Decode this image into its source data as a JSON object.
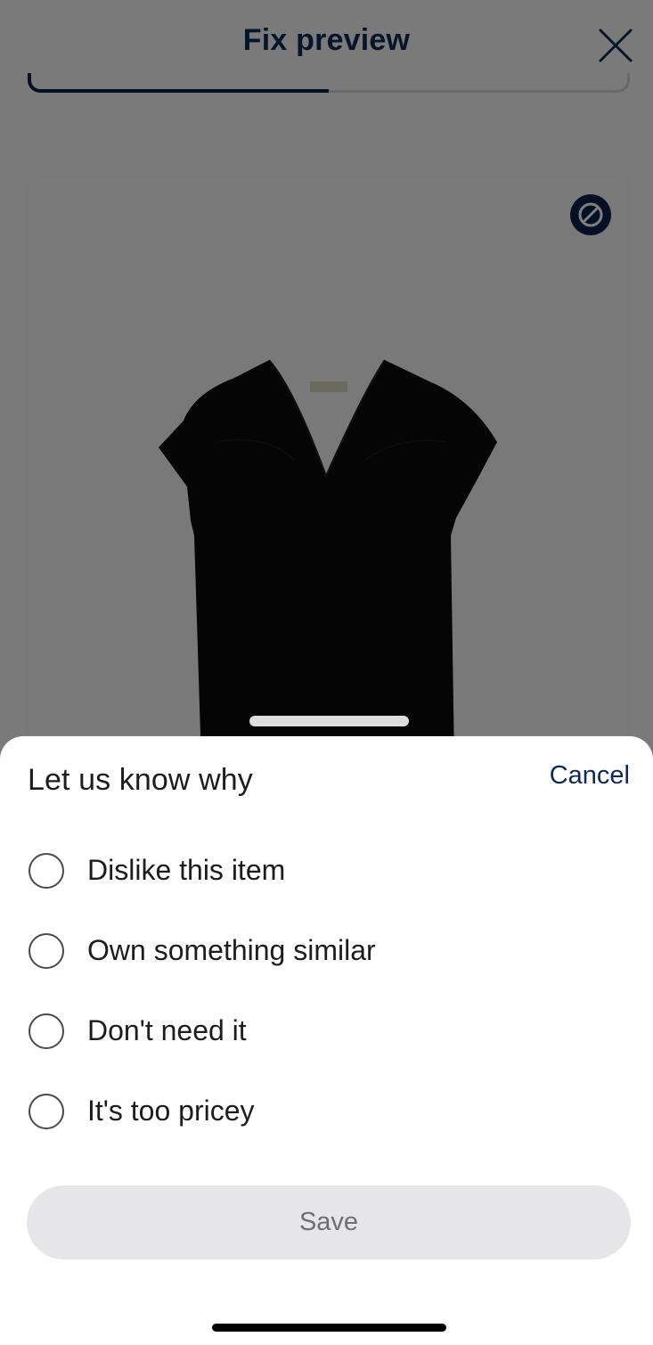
{
  "header": {
    "title": "Fix preview",
    "close_icon": "close-icon",
    "progress_fraction": 0.5
  },
  "product": {
    "badge_icon": "block-icon",
    "image_alt": "black v-neck flutter sleeve blouse"
  },
  "sheet": {
    "title": "Let us know why",
    "cancel_label": "Cancel",
    "options": [
      {
        "label": "Dislike this item",
        "selected": false
      },
      {
        "label": "Own something similar",
        "selected": false
      },
      {
        "label": "Don't need it",
        "selected": false
      },
      {
        "label": "It's too pricey",
        "selected": false
      }
    ],
    "save_label": "Save"
  },
  "colors": {
    "brand_navy": "#0f2a57",
    "save_disabled_bg": "#e6e6e8"
  }
}
